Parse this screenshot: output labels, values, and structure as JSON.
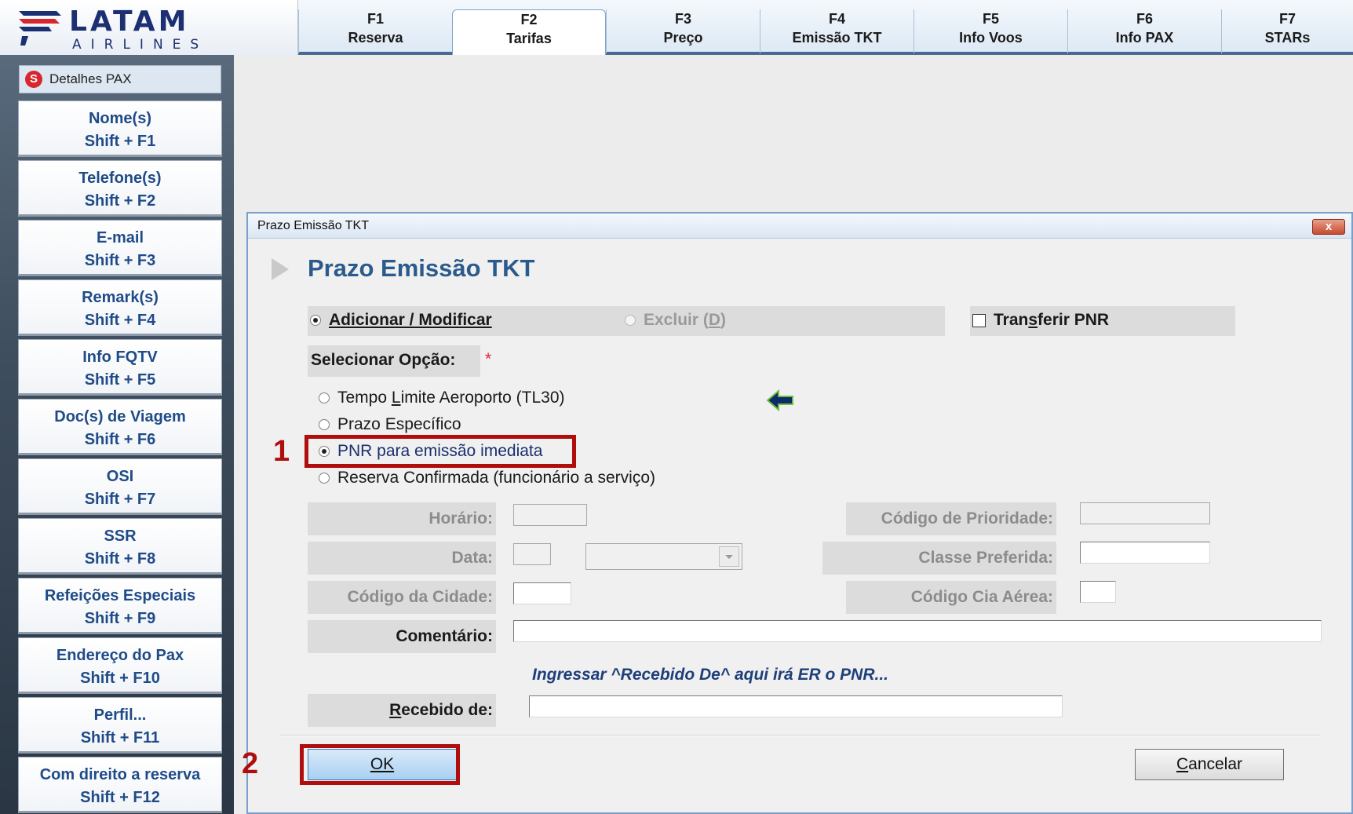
{
  "logo": {
    "name": "LATAM",
    "sub": "AIRLINES"
  },
  "tabs": [
    {
      "key": "F1",
      "label": "Reserva"
    },
    {
      "key": "F2",
      "label": "Tarifas"
    },
    {
      "key": "F3",
      "label": "Preço"
    },
    {
      "key": "F4",
      "label": "Emissão TKT"
    },
    {
      "key": "F5",
      "label": "Info Voos"
    },
    {
      "key": "F6",
      "label": "Info PAX"
    },
    {
      "key": "F7",
      "label": "STARs"
    }
  ],
  "sidebar": {
    "header": "Detalhes PAX",
    "header_icon": "S",
    "items": [
      {
        "label": "Nome(s)",
        "shortcut": "Shift + F1"
      },
      {
        "label": "Telefone(s)",
        "shortcut": "Shift + F2"
      },
      {
        "label": "E-mail",
        "shortcut": "Shift + F3"
      },
      {
        "label": "Remark(s)",
        "shortcut": "Shift + F4"
      },
      {
        "label": "Info FQTV",
        "shortcut": "Shift + F5"
      },
      {
        "label": "Doc(s) de Viagem",
        "shortcut": "Shift + F6"
      },
      {
        "label": "OSI",
        "shortcut": "Shift + F7"
      },
      {
        "label": "SSR",
        "shortcut": "Shift + F8"
      },
      {
        "label": "Refeições Especiais",
        "shortcut": "Shift + F9"
      },
      {
        "label": "Endereço do Pax",
        "shortcut": "Shift + F10"
      },
      {
        "label": "Perfil...",
        "shortcut": "Shift + F11"
      },
      {
        "label": "Com direito a reserva",
        "shortcut": "Shift + F12"
      }
    ]
  },
  "dialog": {
    "title": "Prazo Emissão TKT",
    "close_label": "x",
    "heading": "Prazo Emissão TKT",
    "mode": {
      "add_modify": "Adicionar / Modificar",
      "delete_pre": "Excluir (",
      "delete_key": "D",
      "delete_post": ")",
      "transfer_pre": "Tran",
      "transfer_key": "s",
      "transfer_post": "ferir PNR"
    },
    "select_option_label": "Selecionar Opção:",
    "required_mark": "*",
    "options": {
      "tl30_pre": "Tempo ",
      "tl30_key": "L",
      "tl30_post": "imite Aeroporto (TL30)",
      "specific": "Prazo Específico",
      "immediate": "PNR para emissão imediata",
      "confirmed": "Reserva Confirmada (funcionário a serviço)"
    },
    "selected_option": "immediate",
    "fields": {
      "horario": "Horário:",
      "data": "Data:",
      "codigo_cidade": "Código da Cidade:",
      "comentario": "Comentário:",
      "codigo_prioridade": "Código de Prioridade:",
      "classe_preferida": "Classe Preferida:",
      "codigo_cia": "Código Cia Aérea:",
      "recebido_key": "R",
      "recebido_rest": "ecebido de:"
    },
    "hint": "Ingressar ^Recebido De^ aqui irá ER o PNR...",
    "ok_label": "OK",
    "cancel_key": "C",
    "cancel_rest": "ancelar"
  },
  "annotations": {
    "step1": "1",
    "step2": "2"
  },
  "colors": {
    "accent": "#2a5b8c",
    "annotation": "#b00d0d",
    "brand": "#1c2f73"
  }
}
